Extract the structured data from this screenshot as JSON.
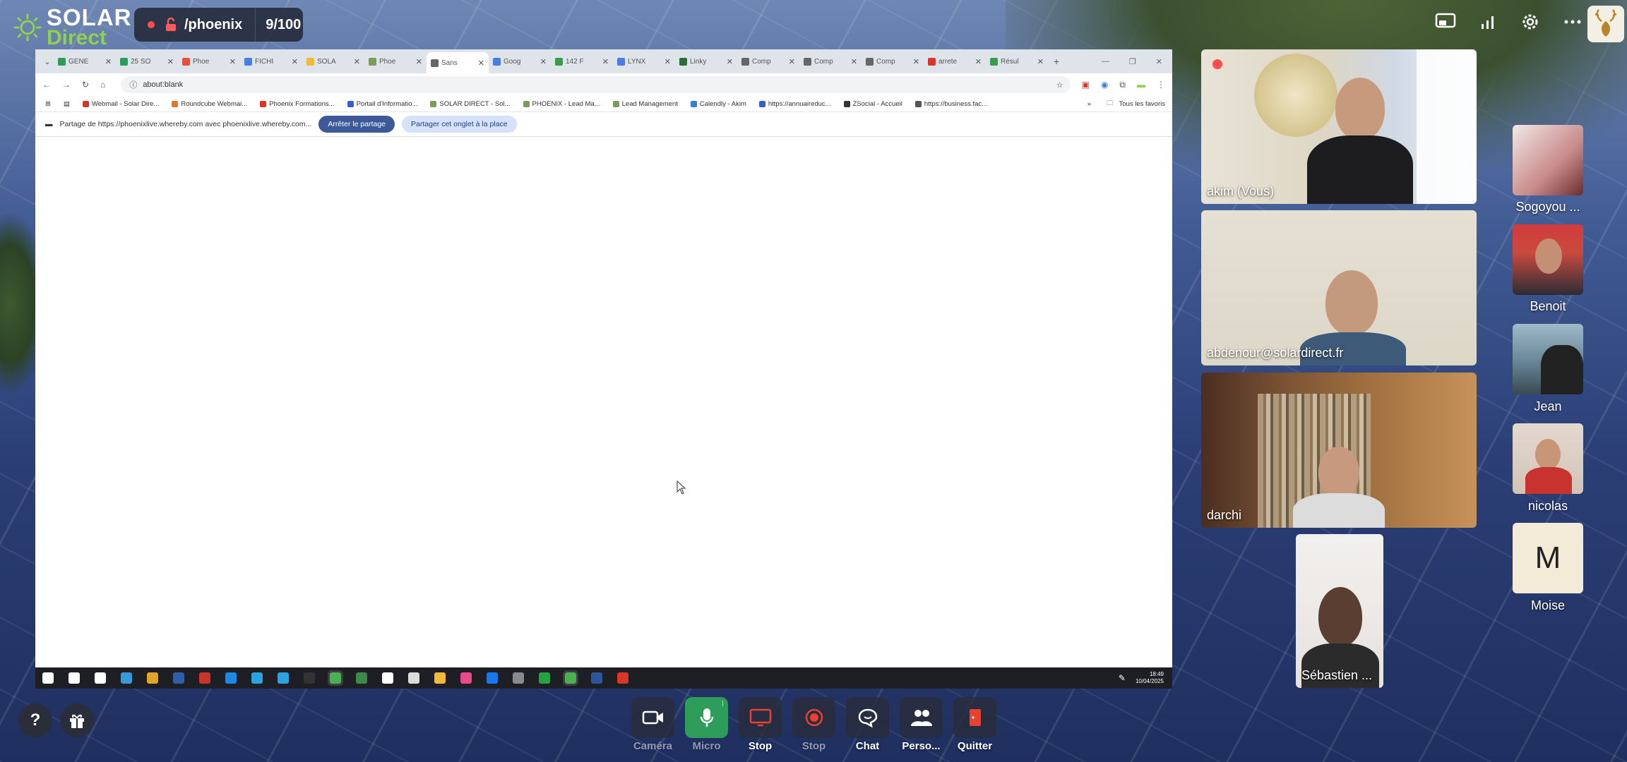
{
  "brand": {
    "line1": "SOLAR",
    "line2": "Direct"
  },
  "room": {
    "name": "/phoenix",
    "count": "9/100"
  },
  "colors": {
    "accent_green": "#8fd14f",
    "mic_active": "#2e9c5b",
    "record_red": "#ff4d4d",
    "share_stop": "#3c5a9a"
  },
  "top_icons": [
    "screen-share-icon",
    "signal-icon",
    "settings-icon",
    "more-icon"
  ],
  "shared_screen": {
    "tabs": [
      {
        "title": "GENE",
        "color": "#2e9c5b"
      },
      {
        "title": "25 SO",
        "color": "#2e9c5b"
      },
      {
        "title": "Phoe",
        "color": "#e0523d"
      },
      {
        "title": "FICHI",
        "color": "#4a7de0"
      },
      {
        "title": "SOLA",
        "color": "#f2b93b"
      },
      {
        "title": "Phoe",
        "color": "#7a9c5b"
      },
      {
        "title": "Sans",
        "color": "#666666",
        "active": true
      },
      {
        "title": "Goog",
        "color": "#4a7de0"
      },
      {
        "title": "142 F",
        "color": "#3a9a4f"
      },
      {
        "title": "LYNX",
        "color": "#4a7de0"
      },
      {
        "title": "Linky",
        "color": "#2e6b3b"
      },
      {
        "title": "Comp",
        "color": "#666666"
      },
      {
        "title": "Comp",
        "color": "#666666"
      },
      {
        "title": "Comp",
        "color": "#666666"
      },
      {
        "title": "arrete",
        "color": "#d9352b"
      },
      {
        "title": "Résul",
        "color": "#3a9a4f"
      }
    ],
    "address": "about:blank",
    "bookmarks": [
      {
        "label": "Webmail - Solar Dire...",
        "color": "#d9352b"
      },
      {
        "label": "Roundcube Webmai...",
        "color": "#e07a2b"
      },
      {
        "label": "Phoenix Formations...",
        "color": "#d9352b"
      },
      {
        "label": "Portail d'Informatio...",
        "color": "#3a5ad9"
      },
      {
        "label": "SOLAR DIRECT - Sol...",
        "color": "#7a9c5b"
      },
      {
        "label": "PHOENIX - Lead Ma...",
        "color": "#7a9c5b"
      },
      {
        "label": "Lead Management",
        "color": "#7a9c5b"
      },
      {
        "label": "Calendly - Akim",
        "color": "#3a7ad9"
      },
      {
        "label": "https://annuaireduc...",
        "color": "#3a5ad9"
      },
      {
        "label": "ZSocial - Accueil",
        "color": "#333333"
      },
      {
        "label": "https://business.fac...",
        "color": "#555555"
      }
    ],
    "bookmarks_more": "»",
    "all_favorites": "Tous les favoris",
    "share_notice": "Partage de https://phoenixlive.whereby.com avec phoenixlive.whereby.com...",
    "stop_share": "Arrêter le partage",
    "share_here": "Partager cet onglet à la place",
    "taskbar_icons": [
      "#ffffff",
      "#ffffff",
      "#ffffff",
      "#3a9ad9",
      "#e0a52b",
      "#2e5fa8",
      "#c9352b",
      "#1e88e5",
      "#2aa3e0",
      "#2aa3e0",
      "#333333",
      "#4caf50",
      "#3a8a4a",
      "#ffffff",
      "#dcdcdc",
      "#f2b93b",
      "#e84a8a",
      "#1877f2",
      "#8a8a8a",
      "#25a244",
      "#4caf50",
      "#2b579a",
      "#d9352b"
    ],
    "clock_time": "18:49",
    "clock_date": "10/04/2025"
  },
  "participants": [
    {
      "name": "akim (Vous)"
    },
    {
      "name": "abdenour@solardirect.fr"
    },
    {
      "name": "darchi"
    },
    {
      "name": "Sébastien ..."
    }
  ],
  "side_participants": [
    {
      "name": "Sogoyou ..."
    },
    {
      "name": "Benoit"
    },
    {
      "name": "Jean"
    },
    {
      "name": "nicolas"
    },
    {
      "name": "Moise",
      "initial": "M"
    }
  ],
  "help_label": "?",
  "controls": [
    {
      "label": "Caméra",
      "dim": true
    },
    {
      "label": "Micro",
      "dim": true
    },
    {
      "label": "Stop",
      "dim": false
    },
    {
      "label": "Stop",
      "dim": true
    },
    {
      "label": "Chat",
      "dim": false
    },
    {
      "label": "Perso...",
      "dim": false
    },
    {
      "label": "Quitter",
      "dim": false
    }
  ]
}
